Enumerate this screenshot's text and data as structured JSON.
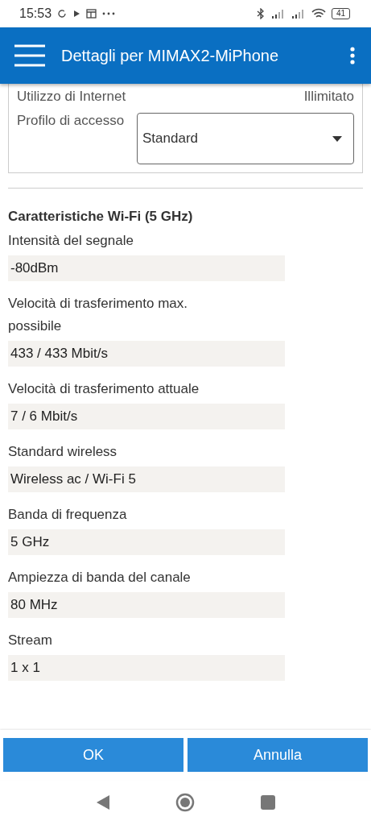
{
  "status_bar": {
    "time": "15:53",
    "battery": "41"
  },
  "app_bar": {
    "title": "Dettagli per MIMAX2-MiPhone"
  },
  "card": {
    "rows": [
      {
        "label": "Utilizzo di Internet",
        "value": "Illimitato"
      }
    ],
    "access_profile": {
      "label": "Profilo di accesso",
      "value": "Standard"
    }
  },
  "section": {
    "title": "Caratteristiche Wi-Fi (5 GHz)",
    "fields": [
      {
        "label": "Intensità del segnale",
        "value": "-80dBm"
      },
      {
        "label": "Velocità di trasferimento max. possibile",
        "value": "433 / 433 Mbit/s"
      },
      {
        "label": "Velocità di trasferimento attuale",
        "value": "7 / 6 Mbit/s"
      },
      {
        "label": "Standard wireless",
        "value": "Wireless ac / Wi-Fi 5"
      },
      {
        "label": "Banda di frequenza",
        "value": "5 GHz"
      },
      {
        "label": "Ampiezza di banda del canale",
        "value": "80 MHz"
      },
      {
        "label": "Stream",
        "value": "1 x 1"
      }
    ]
  },
  "buttons": [
    "OK",
    "Annulla"
  ]
}
